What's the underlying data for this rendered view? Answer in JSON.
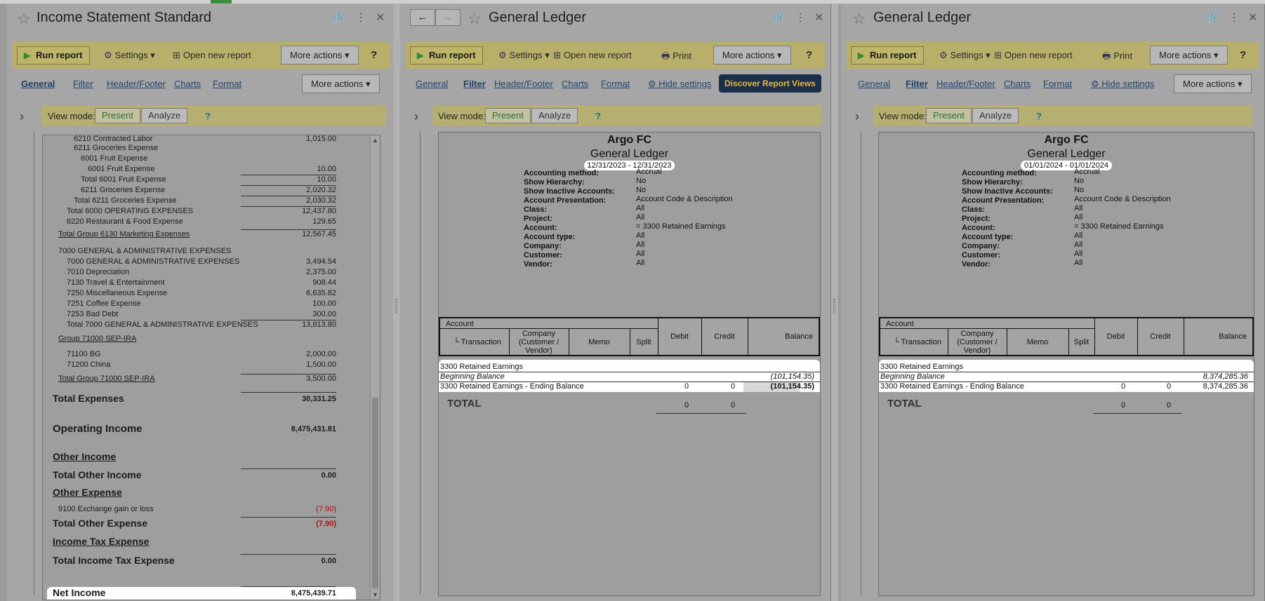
{
  "panels": [
    {
      "title": "Income Statement Standard",
      "toolbar": {
        "run": "Run report",
        "settings": "Settings",
        "open_new": "Open new report",
        "more_actions": "More actions",
        "help": "?"
      },
      "tabs": [
        "General",
        "Filter",
        "Header/Footer",
        "Charts",
        "Format"
      ],
      "tabs_more_actions": "More actions",
      "view_mode": {
        "label": "View mode:",
        "present": "Present",
        "analyze": "Analyze",
        "help": "?"
      }
    },
    {
      "title": "General Ledger",
      "toolbar": {
        "run": "Run report",
        "settings": "Settings",
        "open_new": "Open new report",
        "print": "Print",
        "more_actions": "More actions",
        "help": "?"
      },
      "tabs": [
        "General",
        "Filter",
        "Header/Footer",
        "Charts",
        "Format"
      ],
      "hide_settings": "Hide settings",
      "discover": "Discover Report Views",
      "view_mode": {
        "label": "View mode:",
        "present": "Present",
        "analyze": "Analyze",
        "help": "?"
      }
    },
    {
      "title": "General Ledger",
      "toolbar": {
        "run": "Run report",
        "settings": "Settings",
        "open_new": "Open new report",
        "print": "Print",
        "more_actions": "More actions",
        "help": "?"
      },
      "tabs": [
        "General",
        "Filter",
        "Header/Footer",
        "Charts",
        "Format"
      ],
      "hide_settings": "Hide settings",
      "tabs_more_actions": "More actions",
      "view_mode": {
        "label": "View mode:",
        "present": "Present",
        "analyze": "Analyze",
        "help": "?"
      }
    }
  ],
  "income_statement": {
    "lines": [
      {
        "label": "6210 Contracted Labor",
        "amount": "1,015.00"
      },
      {
        "label": "6211 Groceries Expense",
        "amount": ""
      },
      {
        "label": "6001 Fruit Expense",
        "amount": ""
      },
      {
        "label": "6001 Fruit Expense",
        "amount": "10.00"
      },
      {
        "label": "Total 6001 Fruit Expense",
        "amount": "10.00"
      },
      {
        "label": "6211 Groceries Expense",
        "amount": "2,020.32"
      },
      {
        "label": "Total 6211 Groceries Expense",
        "amount": "2,030.32"
      },
      {
        "label": "Total 6000 OPERATING EXPENSES",
        "amount": "12,437.80"
      },
      {
        "label": "6220 Restaurant & Food Expense",
        "amount": "129.65"
      },
      {
        "label": "Total Group 6130 Marketing Expenses",
        "amount": "12,567.45"
      },
      {
        "label": "7000 GENERAL & ADMINISTRATIVE EXPENSES",
        "amount": ""
      },
      {
        "label": "7000 GENERAL & ADMINISTRATIVE EXPENSES",
        "amount": "3,494.54"
      },
      {
        "label": "7010 Depreciation",
        "amount": "2,375.00"
      },
      {
        "label": "7130 Travel & Entertainment",
        "amount": "908.44"
      },
      {
        "label": "7250 Miscellaneous Expense",
        "amount": "6,635.82"
      },
      {
        "label": "7251 Coffee Expense",
        "amount": "100.00"
      },
      {
        "label": "7253 Bad Debt",
        "amount": "300.00"
      },
      {
        "label": "Total 7000 GENERAL & ADMINISTRATIVE EXPENSES",
        "amount": "13,813.80"
      },
      {
        "label": "Group 71000 SEP-IRA",
        "amount": ""
      },
      {
        "label": "71100 BG",
        "amount": "2,000.00"
      },
      {
        "label": "71200 China",
        "amount": "1,500.00"
      },
      {
        "label": "Total Group 71000 SEP-IRA",
        "amount": "3,500.00"
      },
      {
        "label": "Total Expenses",
        "amount": "30,331.25"
      },
      {
        "label": "Operating Income",
        "amount": "8,475,431.81"
      },
      {
        "label": "Other Income",
        "amount": ""
      },
      {
        "label": "Total Other Income",
        "amount": "0.00"
      },
      {
        "label": "Other Expense",
        "amount": ""
      },
      {
        "label": "9100 Exchange gain or loss",
        "amount": "(7.90)"
      },
      {
        "label": "Total Other Expense",
        "amount": "(7.90)"
      },
      {
        "label": "Income Tax Expense",
        "amount": ""
      },
      {
        "label": "Total Income Tax Expense",
        "amount": "0.00"
      },
      {
        "label": "Net Income",
        "amount": "8,475,439.71"
      }
    ]
  },
  "ledgers": [
    {
      "company": "Argo FC",
      "report_name": "General Ledger",
      "date_range": "12/31/2023 - 12/31/2023",
      "filters": [
        {
          "label": "Accounting method:",
          "value": "Accrual"
        },
        {
          "label": "Show Hierarchy:",
          "value": "No"
        },
        {
          "label": "Show Inactive Accounts:",
          "value": "No"
        },
        {
          "label": "Account Presentation:",
          "value": "Account Code & Description"
        },
        {
          "label": "Class:",
          "value": "All"
        },
        {
          "label": "Project:",
          "value": "All"
        },
        {
          "label": "Account:",
          "value": "= 3300 Retained Earnings"
        },
        {
          "label": "Account type:",
          "value": "All"
        },
        {
          "label": "Company:",
          "value": "All"
        },
        {
          "label": "Customer:",
          "value": "All"
        },
        {
          "label": "Vendor:",
          "value": "All"
        }
      ],
      "columns": {
        "account": "Account",
        "transaction": "└ Transaction",
        "company": "Company (Customer / Vendor)",
        "memo": "Memo",
        "split": "Split",
        "debit": "Debit",
        "credit": "Credit",
        "balance": "Balance"
      },
      "account_name": "3300 Retained Earnings",
      "beginning_label": "Beginning Balance",
      "beginning_balance": "(101,154.35)",
      "ending_label": "3300 Retained Earnings - Ending Balance",
      "ending_debit": "0",
      "ending_credit": "0",
      "ending_balance": "(101,154.35)",
      "total_label": "TOTAL",
      "total_debit": "0",
      "total_credit": "0"
    },
    {
      "company": "Argo FC",
      "report_name": "General Ledger",
      "date_range": "01/01/2024 - 01/01/2024",
      "filters": [
        {
          "label": "Accounting method:",
          "value": "Accrual"
        },
        {
          "label": "Show Hierarchy:",
          "value": "No"
        },
        {
          "label": "Show Inactive Accounts:",
          "value": "No"
        },
        {
          "label": "Account Presentation:",
          "value": "Account Code & Description"
        },
        {
          "label": "Class:",
          "value": "All"
        },
        {
          "label": "Project:",
          "value": "All"
        },
        {
          "label": "Account:",
          "value": "= 3300 Retained Earnings"
        },
        {
          "label": "Account type:",
          "value": "All"
        },
        {
          "label": "Company:",
          "value": "All"
        },
        {
          "label": "Customer:",
          "value": "All"
        },
        {
          "label": "Vendor:",
          "value": "All"
        }
      ],
      "columns": {
        "account": "Account",
        "transaction": "└ Transaction",
        "company": "Company (Customer / Vendor)",
        "memo": "Memo",
        "split": "Split",
        "debit": "Debit",
        "credit": "Credit",
        "balance": "Balance"
      },
      "account_name": "3300 Retained Earnings",
      "beginning_label": "Beginning Balance",
      "beginning_balance": "8,374,285.36",
      "ending_label": "3300 Retained Earnings - Ending Balance",
      "ending_debit": "0",
      "ending_credit": "0",
      "ending_balance": "8,374,285.36",
      "total_label": "TOTAL",
      "total_debit": "0",
      "total_credit": "0"
    }
  ]
}
